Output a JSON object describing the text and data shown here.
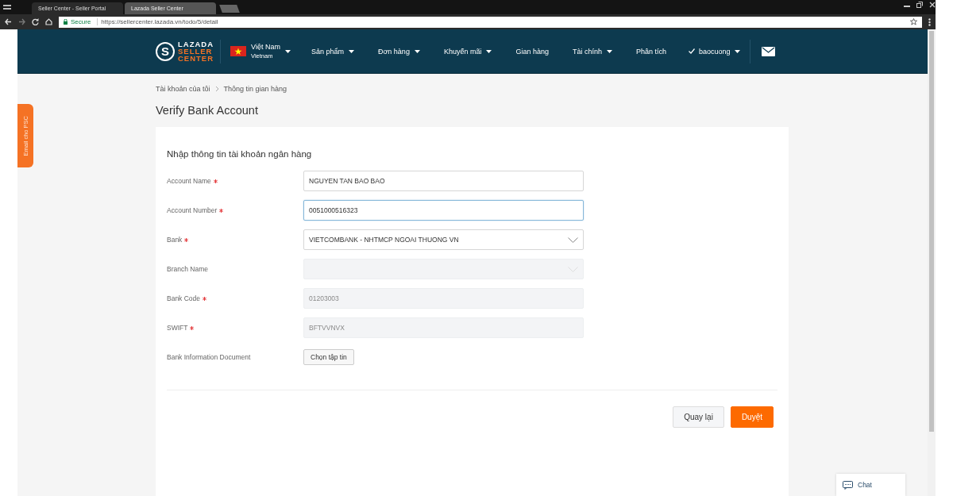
{
  "browser": {
    "tabs": [
      {
        "title": "Seller Center - Seller Portal",
        "selected": true
      },
      {
        "title": "Lazada Seller Center",
        "selected": false
      }
    ],
    "secure_label": "Secure",
    "url": "https://sellercenter.lazada.vn/todo/5/detail"
  },
  "nav": {
    "logo": {
      "mark": "S",
      "lines": [
        "LAZADA",
        "SELLER",
        "CENTER"
      ]
    },
    "country": {
      "name": "Việt Nam",
      "sub": "Vietnam"
    },
    "items": [
      {
        "label": "Sản phẩm",
        "dropdown": true
      },
      {
        "label": "Đơn hàng",
        "dropdown": true
      },
      {
        "label": "Khuyến mãi",
        "dropdown": true
      },
      {
        "label": "Gian hàng",
        "dropdown": false
      },
      {
        "label": "Tài chính",
        "dropdown": true
      },
      {
        "label": "Phân tích",
        "dropdown": false
      }
    ],
    "user": "baocuong"
  },
  "side_tab": "Email cho PSC",
  "breadcrumb": [
    "Tài khoản của tôi",
    "Thông tin gian hàng"
  ],
  "title": "Verify Bank Account",
  "form": {
    "heading": "Nhập thông tin tài khoản ngân hàng",
    "fields": [
      {
        "kind": "text",
        "label": "Account Name",
        "required": true,
        "value": "NGUYEN TAN BAO BAO",
        "disabled": false,
        "focused": false
      },
      {
        "kind": "text",
        "label": "Account Number",
        "required": true,
        "value": "0051000516323",
        "disabled": false,
        "focused": true
      },
      {
        "kind": "select",
        "label": "Bank",
        "required": true,
        "value": "VIETCOMBANK - NHTMCP NGOAI THUONG VN",
        "disabled": false,
        "focused": false
      },
      {
        "kind": "select",
        "label": "Branch Name",
        "required": false,
        "disabled": true,
        "focused": false
      },
      {
        "kind": "text",
        "label": "Bank Code",
        "required": true,
        "value": "01203003",
        "disabled": true,
        "focused": false
      },
      {
        "kind": "text",
        "label": "SWIFT",
        "required": true,
        "value": "BFTVVNVX",
        "disabled": true,
        "focused": false
      },
      {
        "kind": "file",
        "label": "Bank Information Document",
        "required": false,
        "button": "Chọn tập tin"
      }
    ],
    "buttons": [
      {
        "label": "Quay lại",
        "kind": "secondary"
      },
      {
        "label": "Duyệt",
        "kind": "primary"
      }
    ]
  },
  "chat": "Chat"
}
